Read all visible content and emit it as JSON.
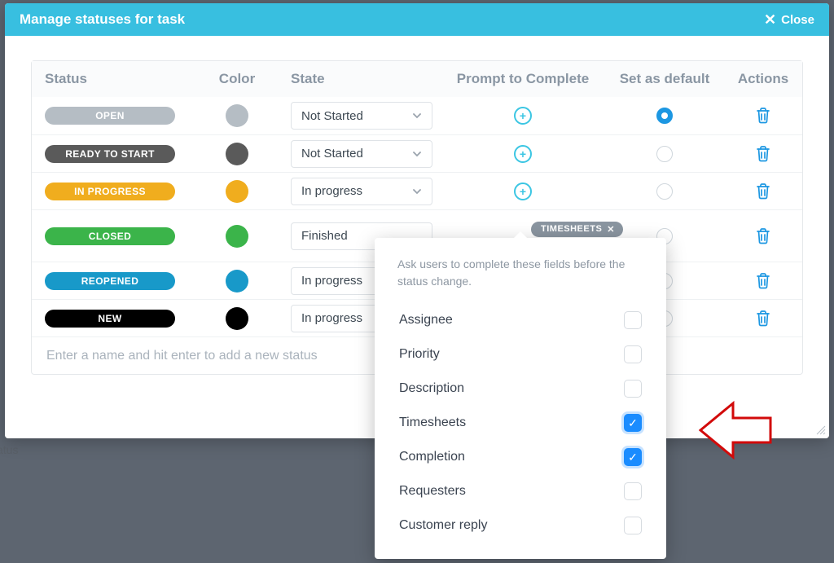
{
  "modal": {
    "title": "Manage statuses for task",
    "close_label": "Close"
  },
  "headers": {
    "status": "Status",
    "color": "Color",
    "state": "State",
    "prompt": "Prompt to Complete",
    "default": "Set as default",
    "actions": "Actions"
  },
  "rows": [
    {
      "label": "OPEN",
      "pill": "#b5bdc4",
      "swatch": "#b5bdc4",
      "state": "Not Started",
      "showChevron": true,
      "tall": false,
      "prompt": "plus",
      "default": true
    },
    {
      "label": "READY TO START",
      "pill": "#5a5a5a",
      "swatch": "#5a5a5a",
      "state": "Not Started",
      "showChevron": true,
      "tall": false,
      "prompt": "plus",
      "default": false
    },
    {
      "label": "IN PROGRESS",
      "pill": "#f0ad1e",
      "swatch": "#f0ad1e",
      "state": "In progress",
      "showChevron": true,
      "tall": false,
      "prompt": "plus",
      "default": false
    },
    {
      "label": "CLOSED",
      "pill": "#3bb44a",
      "swatch": "#3bb44a",
      "state": "Finished",
      "showChevron": false,
      "tall": true,
      "prompt": "chip",
      "chip": "TIMESHEETS",
      "default": false
    },
    {
      "label": "REOPENED",
      "pill": "#1899c9",
      "swatch": "#1899c9",
      "state": "In progress",
      "showChevron": false,
      "tall": false,
      "prompt": "none",
      "default": false
    },
    {
      "label": "NEW",
      "pill": "#000000",
      "swatch": "#000000",
      "state": "In progress",
      "showChevron": false,
      "tall": false,
      "prompt": "none",
      "default": false
    }
  ],
  "new_status_placeholder": "Enter a name and hit enter to add a new status",
  "popover": {
    "description": "Ask users to complete these fields before the status change.",
    "options": [
      {
        "label": "Assignee",
        "checked": false
      },
      {
        "label": "Priority",
        "checked": false
      },
      {
        "label": "Description",
        "checked": false
      },
      {
        "label": "Timesheets",
        "checked": true
      },
      {
        "label": "Completion",
        "checked": true
      },
      {
        "label": "Requesters",
        "checked": false
      },
      {
        "label": "Customer reply",
        "checked": false
      }
    ]
  },
  "background_text": "atus"
}
